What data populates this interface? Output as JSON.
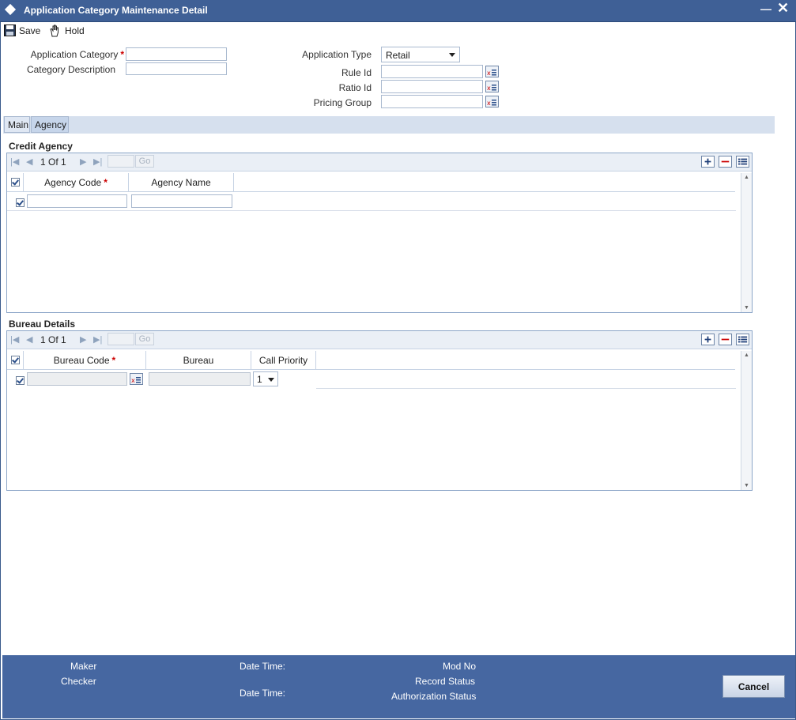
{
  "window": {
    "title": "Application Category Maintenance Detail"
  },
  "toolbar": {
    "save_label": "Save",
    "hold_label": "Hold"
  },
  "form": {
    "application_category_label": "Application Category",
    "category_description_label": "Category Description",
    "application_type_label": "Application Type",
    "application_type_value": "Retail",
    "rule_id_label": "Rule Id",
    "ratio_id_label": "Ratio Id",
    "pricing_group_label": "Pricing Group",
    "required_marker": "*"
  },
  "tabs": [
    {
      "label": "Main"
    },
    {
      "label": "Agency"
    }
  ],
  "credit_agency": {
    "title": "Credit Agency",
    "pager": "1 Of 1",
    "go_label": "Go",
    "columns": [
      "Agency Code",
      "Agency Name"
    ]
  },
  "bureau_details": {
    "title": "Bureau Details",
    "pager": "1 Of 1",
    "go_label": "Go",
    "columns": [
      "Bureau Code",
      "Bureau",
      "Call Priority"
    ],
    "call_priority_value": "1"
  },
  "footer": {
    "maker_label": "Maker",
    "checker_label": "Checker",
    "date_time_label": "Date Time:",
    "mod_no_label": "Mod No",
    "record_status_label": "Record Status",
    "authorization_status_label": "Authorization Status",
    "cancel_label": "Cancel"
  }
}
